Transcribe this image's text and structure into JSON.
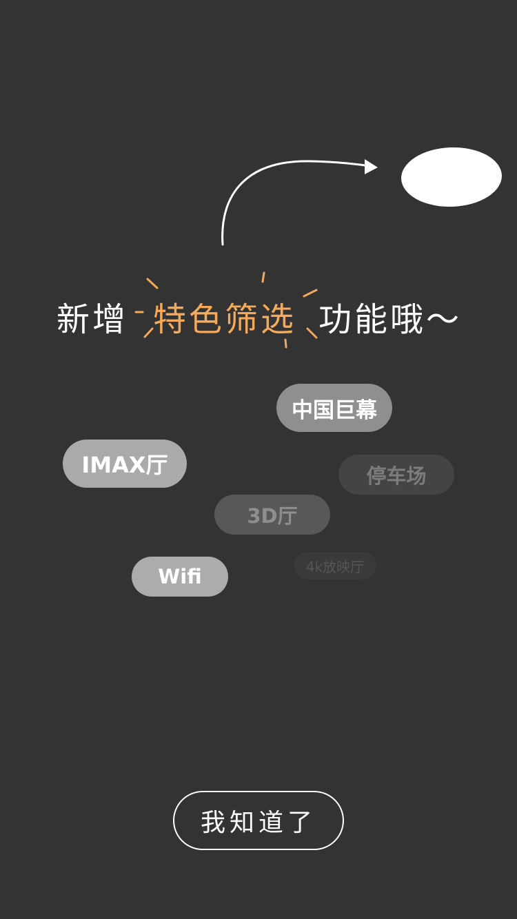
{
  "colors": {
    "background": "#333333",
    "accent": "#F5A95A",
    "white": "#FFFFFF"
  },
  "guide": {
    "headline_pre": "新增",
    "headline_accent": "特色筛选",
    "headline_post": "功能哦～",
    "arrow_icon": "curved-arrow-icon",
    "sparkle_icon": "sparkle-burst-icon"
  },
  "tags": [
    {
      "label": "中国巨幕"
    },
    {
      "label": "IMAX厅"
    },
    {
      "label": "停车场"
    },
    {
      "label": "3D厅"
    },
    {
      "label": "Wifi"
    },
    {
      "label": "4k放映厅"
    }
  ],
  "actions": {
    "confirm_label": "我知道了"
  }
}
